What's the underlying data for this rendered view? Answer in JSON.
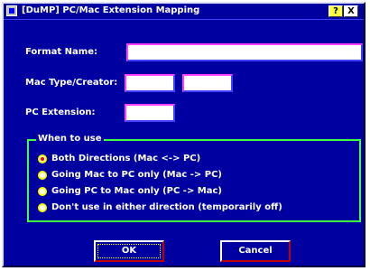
{
  "window": {
    "title": "[DuMP] PC/Mac Extension Mapping",
    "help_button_label": "?",
    "close_button_label": "X"
  },
  "form": {
    "format_name_label": "Format Name:",
    "format_name_value": "",
    "mac_type_creator_label": "Mac Type/Creator:",
    "mac_type_value": "",
    "mac_creator_value": "",
    "pc_extension_label": "PC Extension:",
    "pc_extension_value": ""
  },
  "when_to_use": {
    "title": "When to use",
    "options": [
      {
        "label": "Both Directions (Mac <-> PC)",
        "selected": true
      },
      {
        "label": "Going Mac to PC only (Mac -> PC)",
        "selected": false
      },
      {
        "label": "Going PC to Mac only (PC -> Mac)",
        "selected": false
      },
      {
        "label": "Don't use in either direction (temporarily off)",
        "selected": false
      }
    ]
  },
  "buttons": {
    "ok_label": "OK",
    "cancel_label": "Cancel"
  },
  "colors": {
    "background": "#0000a0",
    "text": "#ffffff",
    "groupbox_border": "#40ff40",
    "selected_radio": "#ff0000"
  }
}
